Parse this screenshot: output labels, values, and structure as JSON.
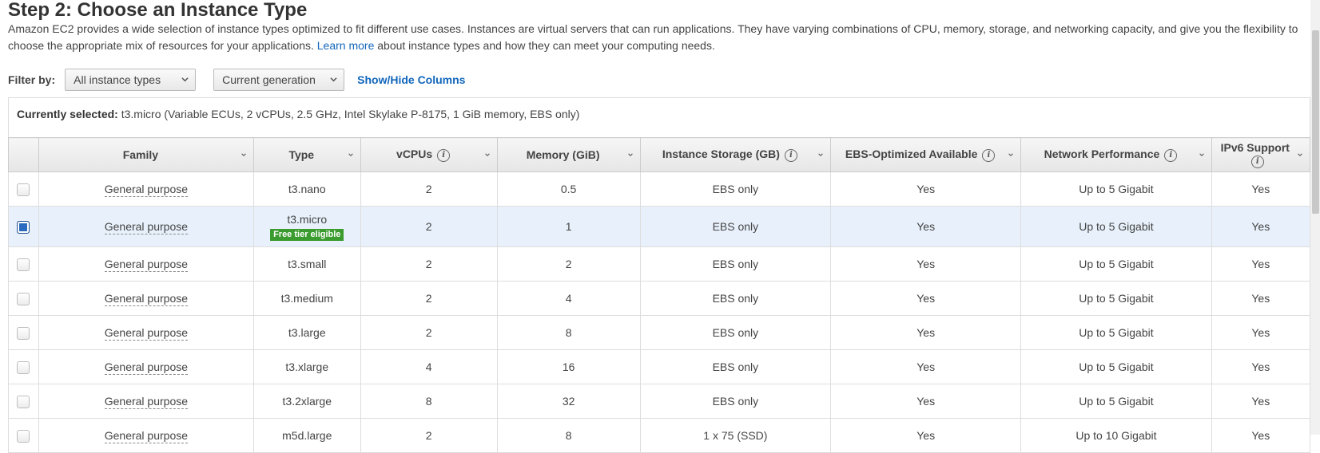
{
  "header": {
    "title": "Step 2: Choose an Instance Type",
    "description_before_link": "Amazon EC2 provides a wide selection of instance types optimized to fit different use cases. Instances are virtual servers that can run applications. They have varying combinations of CPU, memory, storage, and networking capacity, and give you the flexibility to choose the appropriate mix of resources for your applications.",
    "learn_more_link": "Learn more",
    "description_after_link": "about instance types and how they can meet your computing needs."
  },
  "filter": {
    "label": "Filter by:",
    "instance_types_select": "All instance types",
    "generation_select": "Current generation",
    "show_hide_columns": "Show/Hide Columns"
  },
  "current_selection": {
    "label": "Currently selected:",
    "value": "t3.micro (Variable ECUs, 2 vCPUs, 2.5 GHz, Intel Skylake P-8175, 1 GiB memory, EBS only)"
  },
  "table": {
    "columns": [
      "Family",
      "Type",
      "vCPUs",
      "Memory (GiB)",
      "Instance Storage (GB)",
      "EBS-Optimized Available",
      "Network Performance",
      "IPv6 Support"
    ],
    "columns_with_info": [
      false,
      false,
      true,
      false,
      true,
      true,
      true,
      true
    ],
    "rows": [
      {
        "family": "General purpose",
        "type": "t3.nano",
        "vcpus": "2",
        "memory": "0.5",
        "storage": "EBS only",
        "ebs": "Yes",
        "network": "Up to 5 Gigabit",
        "ipv6": "Yes",
        "checked": false,
        "badge": ""
      },
      {
        "family": "General purpose",
        "type": "t3.micro",
        "vcpus": "2",
        "memory": "1",
        "storage": "EBS only",
        "ebs": "Yes",
        "network": "Up to 5 Gigabit",
        "ipv6": "Yes",
        "checked": true,
        "badge": "Free tier eligible"
      },
      {
        "family": "General purpose",
        "type": "t3.small",
        "vcpus": "2",
        "memory": "2",
        "storage": "EBS only",
        "ebs": "Yes",
        "network": "Up to 5 Gigabit",
        "ipv6": "Yes",
        "checked": false,
        "badge": ""
      },
      {
        "family": "General purpose",
        "type": "t3.medium",
        "vcpus": "2",
        "memory": "4",
        "storage": "EBS only",
        "ebs": "Yes",
        "network": "Up to 5 Gigabit",
        "ipv6": "Yes",
        "checked": false,
        "badge": ""
      },
      {
        "family": "General purpose",
        "type": "t3.large",
        "vcpus": "2",
        "memory": "8",
        "storage": "EBS only",
        "ebs": "Yes",
        "network": "Up to 5 Gigabit",
        "ipv6": "Yes",
        "checked": false,
        "badge": ""
      },
      {
        "family": "General purpose",
        "type": "t3.xlarge",
        "vcpus": "4",
        "memory": "16",
        "storage": "EBS only",
        "ebs": "Yes",
        "network": "Up to 5 Gigabit",
        "ipv6": "Yes",
        "checked": false,
        "badge": ""
      },
      {
        "family": "General purpose",
        "type": "t3.2xlarge",
        "vcpus": "8",
        "memory": "32",
        "storage": "EBS only",
        "ebs": "Yes",
        "network": "Up to 5 Gigabit",
        "ipv6": "Yes",
        "checked": false,
        "badge": ""
      },
      {
        "family": "General purpose",
        "type": "m5d.large",
        "vcpus": "2",
        "memory": "8",
        "storage": "1 x 75 (SSD)",
        "ebs": "Yes",
        "network": "Up to 10 Gigabit",
        "ipv6": "Yes",
        "checked": false,
        "badge": ""
      }
    ]
  },
  "icons": {
    "info": "info-icon",
    "sort": "sort-chevron-icon",
    "dropdown": "chevron-down-icon"
  },
  "colors": {
    "link": "#1166bb",
    "badge": "#3a9b2e",
    "selected_row": "#e8f1fb",
    "checkbox_checked": "#2a6bbf"
  }
}
